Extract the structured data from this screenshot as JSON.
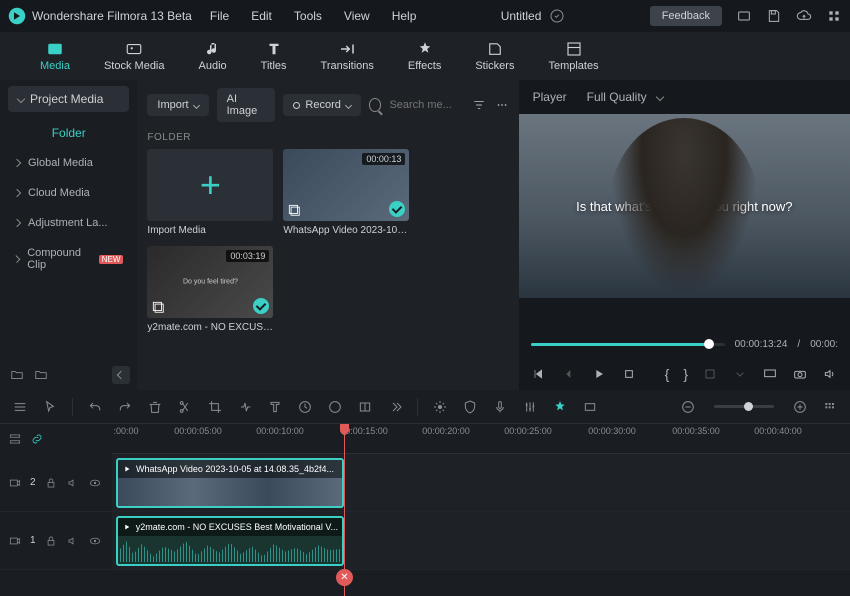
{
  "app": {
    "title": "Wondershare Filmora 13 Beta"
  },
  "menu": {
    "file": "File",
    "edit": "Edit",
    "tools": "Tools",
    "view": "View",
    "help": "Help"
  },
  "doc": {
    "name": "Untitled"
  },
  "titlebar": {
    "feedback": "Feedback"
  },
  "tabs": {
    "media": "Media",
    "stock": "Stock Media",
    "audio": "Audio",
    "titles": "Titles",
    "transitions": "Transitions",
    "effects": "Effects",
    "stickers": "Stickers",
    "templates": "Templates"
  },
  "sidebar": {
    "header": "Project Media",
    "folder": "Folder",
    "items": [
      "Global Media",
      "Cloud Media",
      "Adjustment La...",
      "Compound Clip"
    ],
    "new_badge": "NEW"
  },
  "mediabar": {
    "import": "Import",
    "ai_image": "AI Image",
    "record": "Record",
    "search_placeholder": "Search me..."
  },
  "mediapanel": {
    "folder_label": "FOLDER",
    "import_media": "Import Media",
    "clip1": {
      "name": "WhatsApp Video 2023-10-05...",
      "duration": "00:00:13"
    },
    "clip2": {
      "name": "y2mate.com - NO EXCUSES ...",
      "duration": "00:03:19"
    }
  },
  "player": {
    "tab": "Player",
    "quality": "Full Quality",
    "subtitle": "Is that what's stopping you right now?",
    "time_current": "00:00:13:24",
    "time_sep": "/",
    "time_total": "00:00:"
  },
  "timeline": {
    "ruler": [
      ":00:00",
      "00:00:05:00",
      "00:00:10:00",
      "00:00:15:00",
      "00:00:20:00",
      "00:00:25:00",
      "00:00:30:00",
      "00:00:35:00",
      "00:00:40:00"
    ],
    "track2_label": "2",
    "track1_label": "1",
    "clip_top": "WhatsApp Video 2023-10-05 at 14.08.35_4b2f4...",
    "clip_bottom": "y2mate.com - NO EXCUSES  Best Motivational V..."
  }
}
